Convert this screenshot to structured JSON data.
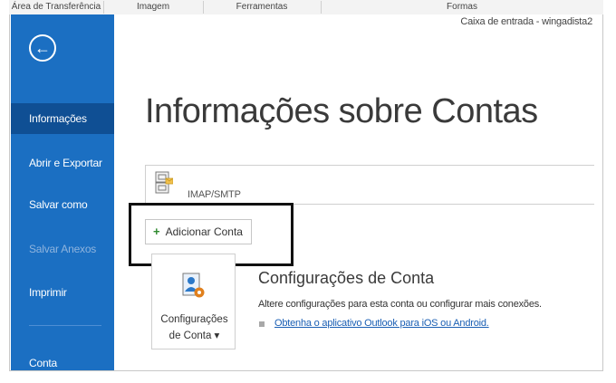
{
  "ribbon": {
    "groups": [
      "Área de Transferência",
      "Imagem",
      "Ferramentas",
      "Formas"
    ]
  },
  "window_title": "Caixa de entrada - wingadista2",
  "sidebar": {
    "items": [
      {
        "label": "Informações",
        "state": "active"
      },
      {
        "label": "Abrir e Exportar",
        "state": "normal"
      },
      {
        "label": "Salvar como",
        "state": "normal"
      },
      {
        "label": "Salvar Anexos",
        "state": "disabled"
      },
      {
        "label": "Imprimir",
        "state": "normal"
      },
      {
        "label": "Conta",
        "state": "normal"
      }
    ]
  },
  "main": {
    "title": "Informações sobre Contas",
    "account_type": "IMAP/SMTP",
    "add_account_label": "Adicionar Conta",
    "settings_button": {
      "line1": "Configurações",
      "line2": "de Conta ▾"
    },
    "settings_title": "Configurações de Conta",
    "settings_desc": "Altere configurações para esta conta ou configurar mais conexões.",
    "settings_link": "Obtenha o aplicativo Outlook para iOS ou Android."
  },
  "colors": {
    "sidebar": "#1b6fc2",
    "sidebar_active": "#0f4f94",
    "link": "#1a5fb4",
    "plus": "#2f8a2f"
  }
}
